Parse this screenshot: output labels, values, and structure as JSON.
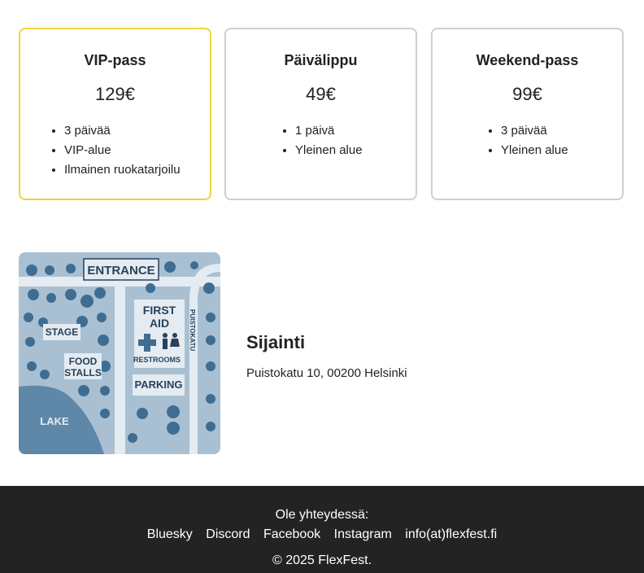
{
  "tickets": [
    {
      "title": "VIP-pass",
      "price": "129€",
      "features": [
        "3 päivää",
        "VIP-alue",
        "Ilmainen ruokatarjoilu"
      ],
      "highlight_color": "#f4d23a"
    },
    {
      "title": "Päivälippu",
      "price": "49€",
      "features": [
        "1 päivä",
        "Yleinen alue"
      ]
    },
    {
      "title": "Weekend-pass",
      "price": "99€",
      "features": [
        "3 päivää",
        "Yleinen alue"
      ]
    }
  ],
  "map": {
    "entrance": "ENTRANCE",
    "first_aid_1": "FIRST",
    "first_aid_2": "AID",
    "restrooms": "RESTROOMS",
    "stage": "STAGE",
    "food_1": "FOOD",
    "food_2": "STALLS",
    "parking": "PARKING",
    "lake": "LAKE",
    "street": "PUISTOKATU"
  },
  "location": {
    "heading": "Sijainti",
    "address": "Puistokatu 10, 00200 Helsinki"
  },
  "footer": {
    "contact_label": "Ole yhteydessä:",
    "links": [
      "Bluesky",
      "Discord",
      "Facebook",
      "Instagram",
      "info(at)flexfest.fi"
    ],
    "copyright": "© 2025 FlexFest."
  },
  "colors": {
    "footer_bg": "#232323",
    "vip_border": "#f4d23a",
    "card_border": "#cfcfcf"
  }
}
